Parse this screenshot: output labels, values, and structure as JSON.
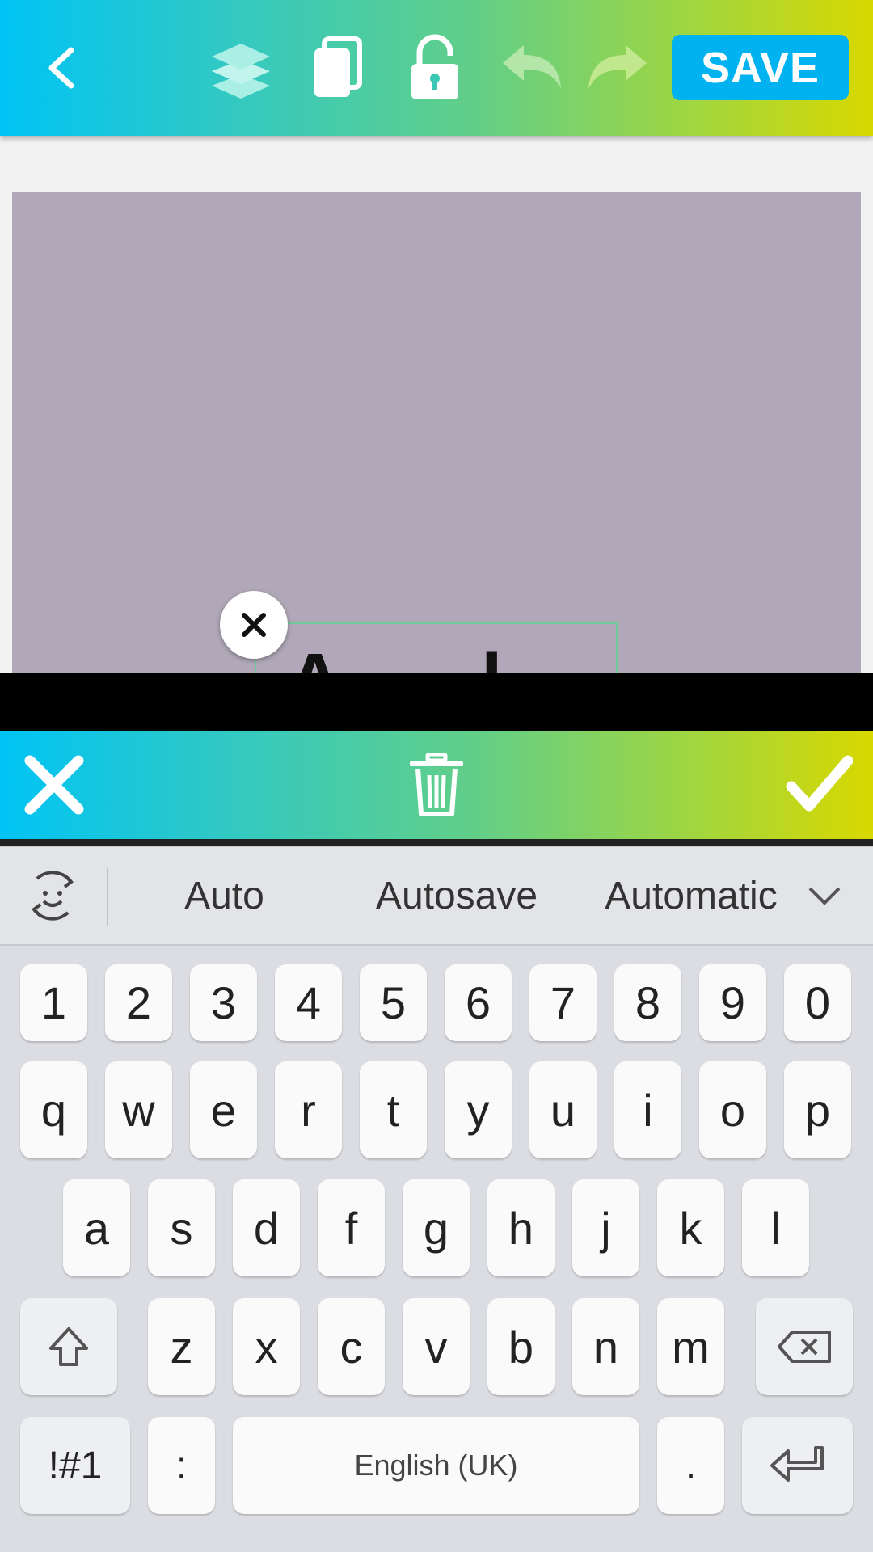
{
  "toolbar": {
    "save_label": "SAVE",
    "colors": {
      "gradient_start": "#00c4f5",
      "gradient_end": "#d8d800",
      "save_bg": "#00b2f0"
    }
  },
  "canvas": {
    "background": "#b0a8b8",
    "text_partial": "A",
    "text_partial2": "l"
  },
  "keyboard": {
    "suggestions": [
      "Auto",
      "Autosave",
      "Automatic"
    ],
    "number_row": [
      "1",
      "2",
      "3",
      "4",
      "5",
      "6",
      "7",
      "8",
      "9",
      "0"
    ],
    "row1": [
      "q",
      "w",
      "e",
      "r",
      "t",
      "y",
      "u",
      "i",
      "o",
      "p"
    ],
    "row2": [
      "a",
      "s",
      "d",
      "f",
      "g",
      "h",
      "j",
      "k",
      "l"
    ],
    "row3": [
      "z",
      "x",
      "c",
      "v",
      "b",
      "n",
      "m"
    ],
    "symbols_label": "!#1",
    "colon_label": ":",
    "space_label": "English (UK)",
    "period_label": "."
  }
}
